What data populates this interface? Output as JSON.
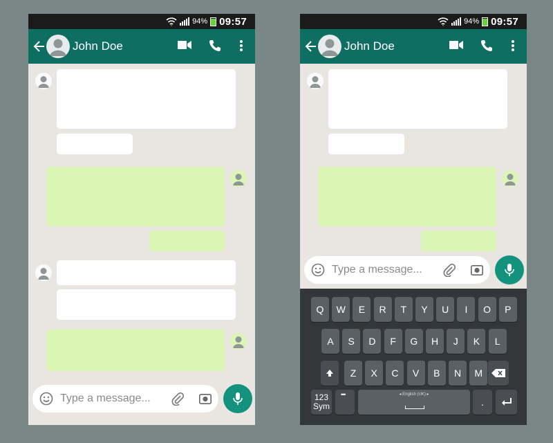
{
  "status_bar": {
    "battery_percent": "94%",
    "time": "09:57",
    "battery_level": 0.94
  },
  "header": {
    "contact_name": "John Doe",
    "back_icon": "arrow-left-icon",
    "video_icon": "video-camera-icon",
    "call_icon": "phone-icon",
    "menu_icon": "more-vert-icon"
  },
  "composer": {
    "placeholder": "Type a message..."
  },
  "keyboard": {
    "row1": [
      "Q",
      "W",
      "E",
      "R",
      "T",
      "Y",
      "U",
      "I",
      "O",
      "P"
    ],
    "row2": [
      "A",
      "S",
      "D",
      "F",
      "G",
      "H",
      "J",
      "K",
      "L"
    ],
    "row3": [
      "Z",
      "X",
      "C",
      "V",
      "B",
      "N",
      "M"
    ],
    "sym_line1": "123",
    "sym_line2": "Sym",
    "language": "English (UK)",
    "period": "."
  },
  "colors": {
    "header": "#0f6e62",
    "chat_bg": "#e9e6e2",
    "incoming": "#ffffff",
    "outgoing": "#dbf5b5",
    "accent": "#14927e",
    "keyboard_bg": "#34373a",
    "key": "#5b6065"
  }
}
